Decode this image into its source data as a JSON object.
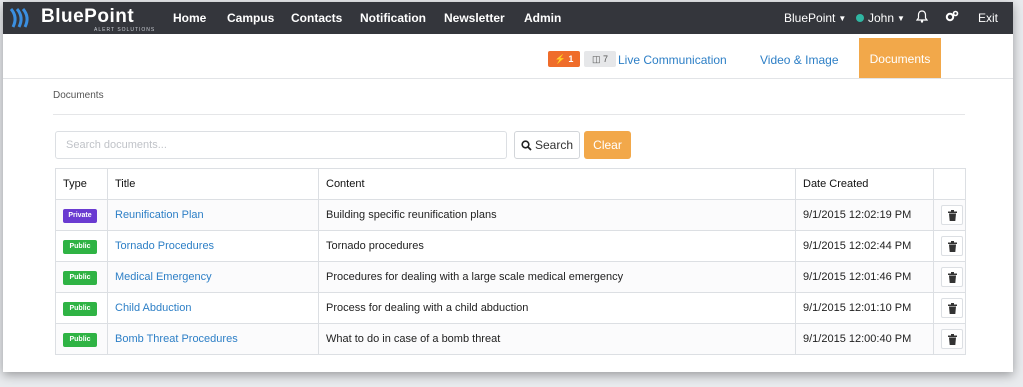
{
  "brand": {
    "name": "BluePoint",
    "tagline": "ALERT SOLUTIONS"
  },
  "nav": {
    "items": [
      "Home",
      "Campus",
      "Contacts",
      "Notification",
      "Newsletter",
      "Admin"
    ]
  },
  "user_menu": {
    "org": "BluePoint",
    "user": "John",
    "exit": "Exit",
    "status_color": "#2fb6a2"
  },
  "subnav": {
    "alert_count": "1",
    "message_count": "7",
    "live": "Live Communication",
    "video": "Video & Image",
    "documents": "Documents",
    "active_color": "#f2a84a"
  },
  "breadcrumb": "Documents",
  "search": {
    "placeholder": "Search documents...",
    "button": "Search",
    "clear": "Clear"
  },
  "table": {
    "headers": {
      "type": "Type",
      "title": "Title",
      "content": "Content",
      "date": "Date Created"
    },
    "rows": [
      {
        "type": "Private",
        "type_color": "#6a3bd1",
        "title": "Reunification Plan",
        "content": "Building specific reunification plans",
        "date": "9/1/2015 12:02:19 PM"
      },
      {
        "type": "Public",
        "type_color": "#2fb344",
        "title": "Tornado Procedures",
        "content": "Tornado procedures",
        "date": "9/1/2015 12:02:44 PM"
      },
      {
        "type": "Public",
        "type_color": "#2fb344",
        "title": "Medical Emergency",
        "content": "Procedures for dealing with a large scale medical emergency",
        "date": "9/1/2015 12:01:46 PM"
      },
      {
        "type": "Public",
        "type_color": "#2fb344",
        "title": "Child Abduction",
        "content": "Process for dealing with a child abduction",
        "date": "9/1/2015 12:01:10 PM"
      },
      {
        "type": "Public",
        "type_color": "#2fb344",
        "title": "Bomb Threat Procedures",
        "content": "What to do in case of a bomb threat",
        "date": "9/1/2015 12:00:40 PM"
      }
    ]
  }
}
